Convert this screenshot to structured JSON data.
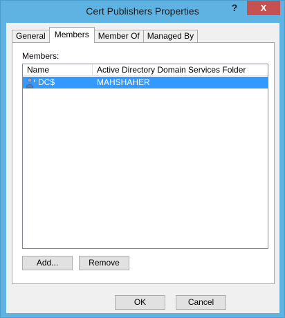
{
  "window": {
    "title": "Cert Publishers Properties",
    "help_label": "?",
    "close_label": "X"
  },
  "tabs": [
    {
      "label": "General",
      "active": false
    },
    {
      "label": "Members",
      "active": true
    },
    {
      "label": "Member Of",
      "active": false
    },
    {
      "label": "Managed By",
      "active": false
    }
  ],
  "members": {
    "label": "Members:",
    "columns": [
      "Name",
      "Active Directory Domain Services Folder"
    ],
    "rows": [
      {
        "name": "DC$",
        "folder": "MAHSHAHER",
        "selected": true
      }
    ],
    "add_label": "Add...",
    "remove_label": "Remove"
  },
  "footer": {
    "ok_label": "OK",
    "cancel_label": "Cancel"
  },
  "colors": {
    "title_bar": "#5fb3e3",
    "close_button": "#c75050",
    "selection": "#3399ff"
  }
}
